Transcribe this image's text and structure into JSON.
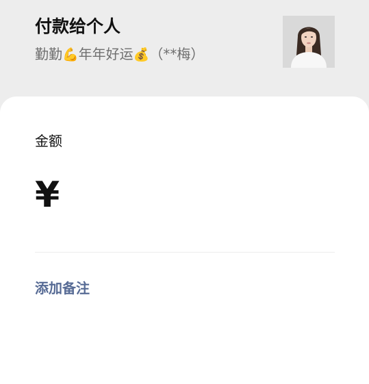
{
  "header": {
    "title": "付款给个人",
    "payee_prefix": "勤勤",
    "payee_emoji_1": "💪",
    "payee_middle": "年年好运",
    "payee_emoji_2": "💰",
    "payee_suffix": "（**梅）",
    "avatar_icon": "profile-photo"
  },
  "amount": {
    "label": "金额",
    "currency_symbol": "¥",
    "value": ""
  },
  "remark": {
    "link_label": "添加备注"
  },
  "colors": {
    "background": "#ededed",
    "card": "#ffffff",
    "link": "#576b95",
    "subtitle": "#6f6f6f"
  }
}
